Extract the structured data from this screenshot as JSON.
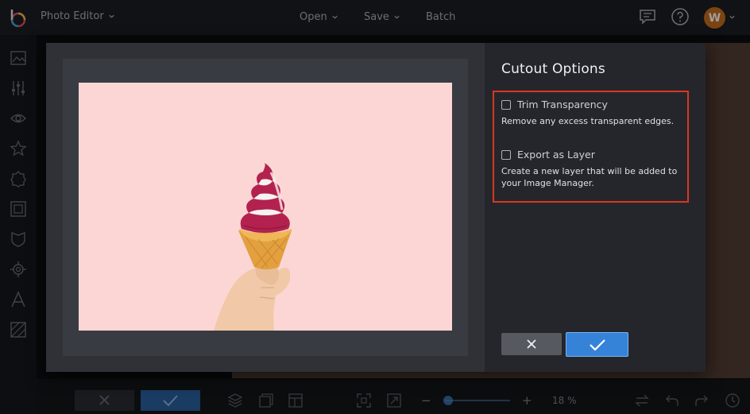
{
  "app": {
    "title": "Photo Editor",
    "avatar_initial": "W"
  },
  "nav": {
    "open_label": "Open",
    "save_label": "Save",
    "batch_label": "Batch"
  },
  "icons": {
    "logo": "befunky-logo-icon",
    "messages": "chat-bubble-icon",
    "help": "help-circle-icon",
    "sidebar": [
      "image-icon",
      "sliders-icon",
      "eye-icon",
      "star-icon",
      "badge-icon",
      "frame-icon",
      "shield-icon",
      "gear-icon",
      "text-icon",
      "texture-icon"
    ],
    "bottom": [
      "layers-icon",
      "image-manager-icon",
      "layout-icon",
      "fit-screen-icon",
      "expand-icon",
      "zoom-out-icon",
      "zoom-in-icon",
      "compare-icon",
      "undo-icon",
      "redo-icon",
      "history-icon"
    ]
  },
  "zoom": {
    "value_label": "18 %",
    "minus": "−",
    "plus": "+"
  },
  "dialog": {
    "title": "Cutout Options",
    "options": [
      {
        "label": "Trim Transparency",
        "checked": false,
        "description": "Remove any excess transparent edges."
      },
      {
        "label": "Export as Layer",
        "checked": false,
        "description": "Create a new layer that will be added to your Image Manager."
      }
    ],
    "cancel_icon": "close-icon",
    "apply_icon": "checkmark-icon"
  },
  "colors": {
    "highlight": "#d9371f",
    "accent": "#3583d8",
    "photo_background": "#fcd6d5",
    "avatar": "#c86f1d"
  }
}
